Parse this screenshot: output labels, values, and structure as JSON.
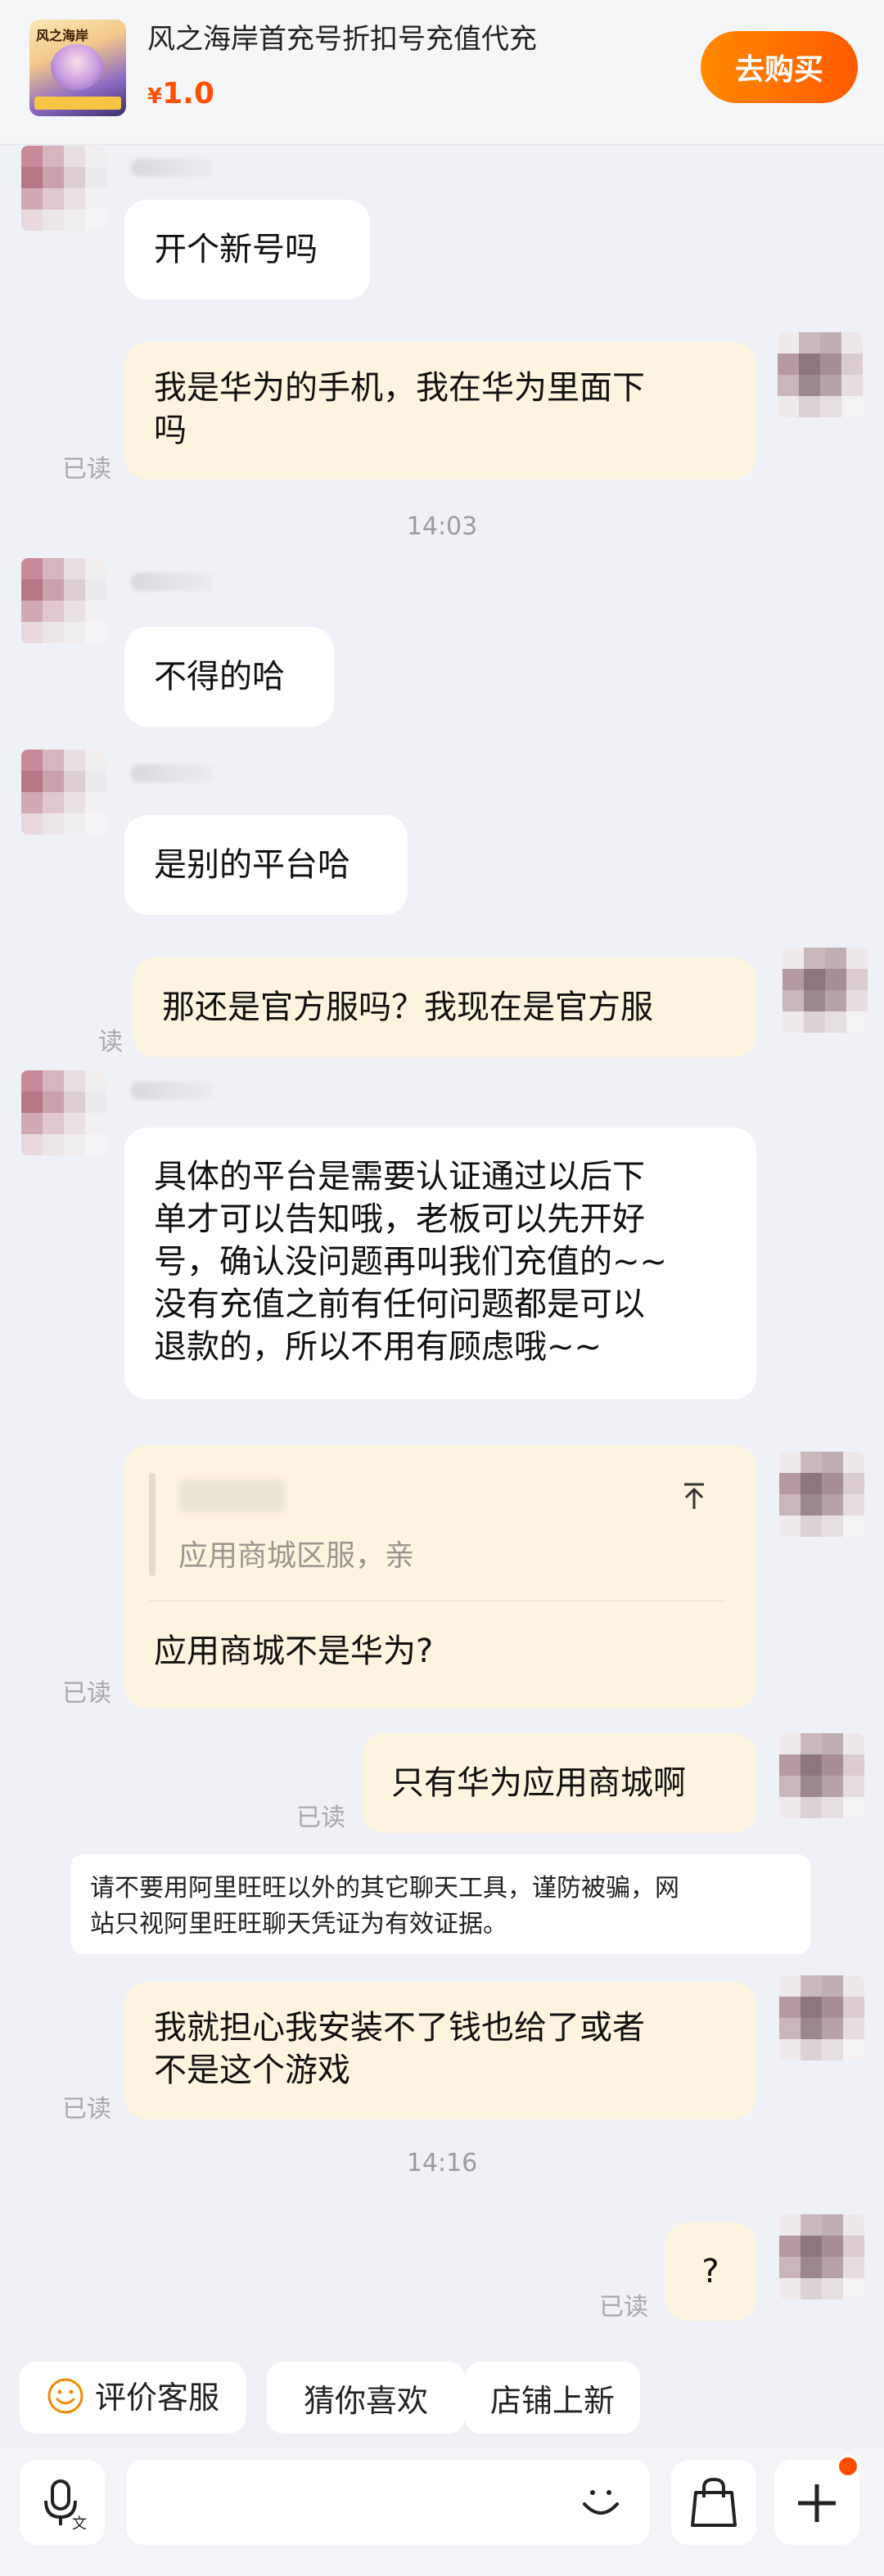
{
  "product": {
    "thumb_title": "风之海岸",
    "title": "风之海岸首充号折扣号充值代充",
    "currency": "¥",
    "price": "1.0",
    "buy_label": "去购买"
  },
  "messages": [
    {
      "side": "left",
      "text": "开个新号吗"
    },
    {
      "side": "right",
      "lines": [
        "我是华为的手机，我在华为里面下",
        "吗"
      ],
      "status": "已读"
    },
    {
      "side": "time",
      "text": "14:03"
    },
    {
      "side": "left",
      "text": "不得的哈"
    },
    {
      "side": "left",
      "text": "是别的平台哈"
    },
    {
      "side": "right",
      "text": "那还是官方服吗？我现在是官方服",
      "status": "读"
    },
    {
      "side": "left",
      "lines": [
        "具体的平台是需要认证通过以后下",
        "单才可以告知哦，老板可以先开好",
        "号，确认没问题再叫我们充值的~~",
        "没有充值之前有任何问题都是可以",
        "退款的，所以不用有顾虑哦~~"
      ]
    },
    {
      "side": "right",
      "quote": "应用商城区服，亲",
      "text": "应用商城不是华为?",
      "status": "已读"
    },
    {
      "side": "right",
      "text": "只有华为应用商城啊",
      "status": "已读"
    },
    {
      "side": "right",
      "lines": [
        "我就担心我安装不了钱也给了或者",
        "不是这个游戏"
      ],
      "status": "已读"
    },
    {
      "side": "time",
      "text": "14:16"
    },
    {
      "side": "right",
      "text": "?",
      "status": "已读"
    }
  ],
  "notice": {
    "lines": [
      "请不要用阿里旺旺以外的其它聊天工具，谨防被骗，网",
      "站只视阿里旺旺聊天凭证为有效证据。"
    ]
  },
  "quick_chips": [
    "评价客服",
    "猜你喜欢",
    "店铺上新"
  ],
  "input_bar": {
    "voice_icon": "microphone-translate-icon",
    "emoji_icon": "smile-icon",
    "bag_icon": "shopping-bag-icon",
    "plus_icon": "plus-icon"
  },
  "colors": {
    "accent": "#ff5000",
    "bubble_self": "#fdf4e0",
    "bubble_other": "#ffffff",
    "background": "#eef1f6"
  }
}
